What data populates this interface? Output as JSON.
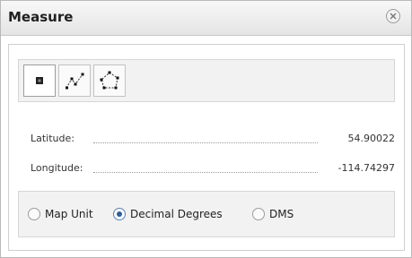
{
  "window": {
    "title": "Measure"
  },
  "tools": [
    {
      "id": "point",
      "icon": "point-icon",
      "active": true
    },
    {
      "id": "line",
      "icon": "polyline-icon",
      "active": false
    },
    {
      "id": "area",
      "icon": "polygon-icon",
      "active": false
    }
  ],
  "readout": {
    "latitude_label": "Latitude:",
    "latitude_value": "54.90022",
    "longitude_label": "Longitude:",
    "longitude_value": "-114.74297"
  },
  "units": {
    "options": [
      "Map Unit",
      "Decimal Degrees",
      "DMS"
    ],
    "selected": "Decimal Degrees"
  },
  "colors": {
    "selected_radio": "#2d5da8"
  }
}
